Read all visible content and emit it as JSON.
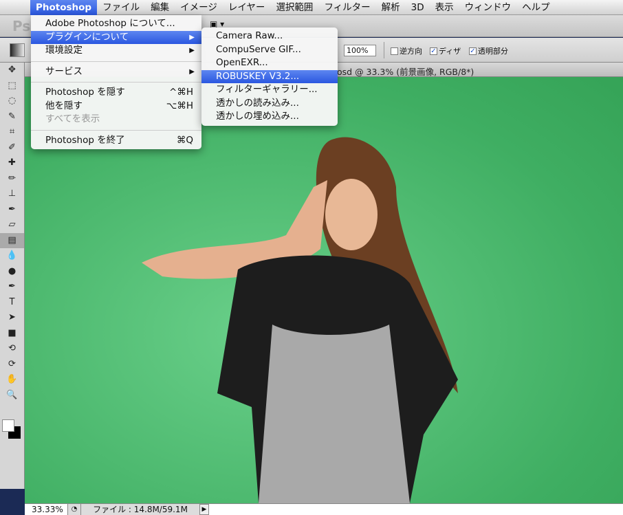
{
  "menubar": {
    "items": [
      "Photoshop",
      "ファイル",
      "編集",
      "イメージ",
      "レイヤー",
      "選択範囲",
      "フィルター",
      "解析",
      "3D",
      "表示",
      "ウィンドウ",
      "ヘルプ"
    ],
    "active": "Photoshop"
  },
  "appbar": {
    "logo": "Ps"
  },
  "options": {
    "opacity": "100%",
    "reverse": "逆方向",
    "reverse_checked": false,
    "dither": "ディザ",
    "dither_checked": true,
    "transparency": "透明部分",
    "transparency_checked": true
  },
  "document": {
    "title": "osd @ 33.3% (前景画像, RGB/8*)"
  },
  "photoshop_menu": {
    "items": [
      {
        "label": "Adobe Photoshop について..."
      },
      {
        "label": "プラグインについて",
        "submenu": true,
        "highlighted": true
      },
      {
        "label": "環境設定",
        "submenu": true
      },
      {
        "sep": true
      },
      {
        "label": "サービス",
        "submenu": true
      },
      {
        "sep": true
      },
      {
        "label": "Photoshop を隠す",
        "shortcut": "^⌘H"
      },
      {
        "label": "他を隠す",
        "shortcut": "⌥⌘H"
      },
      {
        "label": "すべてを表示",
        "disabled": true
      },
      {
        "sep": true
      },
      {
        "label": "Photoshop を終了",
        "shortcut": "⌘Q"
      }
    ]
  },
  "plugin_submenu": {
    "items": [
      {
        "label": "Camera Raw..."
      },
      {
        "label": "CompuServe GIF..."
      },
      {
        "label": "OpenEXR..."
      },
      {
        "label": "ROBUSKEY V3.2...",
        "highlighted": true
      },
      {
        "label": "フィルターギャラリー..."
      },
      {
        "label": "透かしの読み込み..."
      },
      {
        "label": "透かしの埋め込み..."
      }
    ]
  },
  "status": {
    "zoom": "33.33%",
    "file": "ファイル : 14.8M/59.1M"
  },
  "colors": {
    "highlight": "#2a57e0",
    "backdrop": "#3fae62"
  }
}
